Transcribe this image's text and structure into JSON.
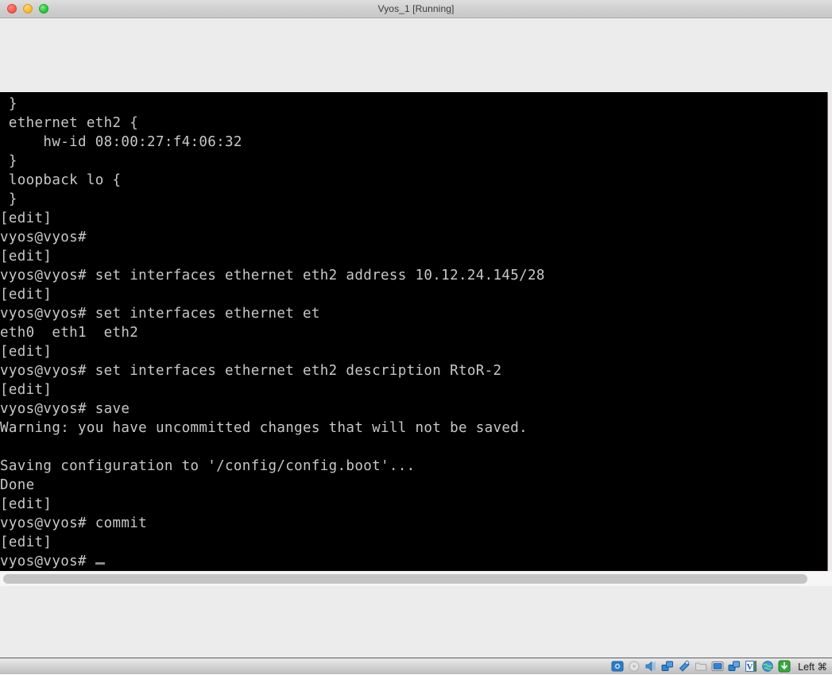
{
  "window": {
    "title": "Vyos_1 [Running]",
    "traffic_lights": [
      {
        "name": "close",
        "color": "#fa5e55"
      },
      {
        "name": "minimize",
        "color": "#ffbd2e"
      },
      {
        "name": "maximize",
        "color": "#2ecc3e"
      }
    ]
  },
  "terminal": {
    "background": "#000000",
    "foreground": "#c8c8c8",
    "lines": [
      " }",
      " ethernet eth2 {",
      "     hw-id 08:00:27:f4:06:32",
      " }",
      " loopback lo {",
      " }",
      "[edit]",
      "vyos@vyos#",
      "[edit]",
      "vyos@vyos# set interfaces ethernet eth2 address 10.12.24.145/28",
      "[edit]",
      "vyos@vyos# set interfaces ethernet et",
      "eth0  eth1  eth2",
      "[edit]",
      "vyos@vyos# set interfaces ethernet eth2 description RtoR-2",
      "[edit]",
      "vyos@vyos# save",
      "Warning: you have uncommitted changes that will not be saved.",
      "",
      "Saving configuration to '/config/config.boot'...",
      "Done",
      "[edit]",
      "vyos@vyos# commit",
      "[edit]"
    ],
    "prompt_line": "vyos@vyos# ",
    "cursor": "block-underscore"
  },
  "statusbar": {
    "host_key_label": "Left ⌘",
    "icons": [
      {
        "name": "hard-disk-icon",
        "color": "#2a7fd4"
      },
      {
        "name": "optical-disk-icon",
        "color": "#b9b9b9"
      },
      {
        "name": "audio-icon",
        "color": "#3b8fd9"
      },
      {
        "name": "network-adapter-icon",
        "color": "#2f86d8"
      },
      {
        "name": "usb-icon",
        "color": "#3e93dd"
      },
      {
        "name": "shared-folders-icon",
        "color": "#cfcfcf"
      },
      {
        "name": "display-icon",
        "color": "#2d82d6"
      },
      {
        "name": "remote-display-icon",
        "color": "#2f86d8"
      },
      {
        "name": "video-capture-icon",
        "color": "#3c79c7"
      },
      {
        "name": "globe-icon",
        "color": "#39a0dd"
      },
      {
        "name": "download-arrow-icon",
        "color": "#37a93f"
      }
    ]
  },
  "scrollbar": {
    "orientation": "horizontal",
    "thumb_color": "#c4c4c4"
  }
}
